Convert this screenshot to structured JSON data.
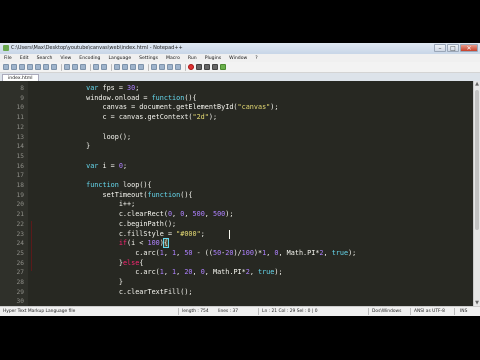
{
  "window": {
    "title": "C:\\Users\\Max\\Desktop\\youtube\\canvas\\web\\index.html - Notepad++",
    "minimize": "–",
    "maximize": "□",
    "close": "✕"
  },
  "menu": [
    "File",
    "Edit",
    "Search",
    "View",
    "Encoding",
    "Language",
    "Settings",
    "Macro",
    "Run",
    "Plugins",
    "Window",
    "?"
  ],
  "tab": {
    "label": "index.html"
  },
  "editor": {
    "lines": [
      {
        "n": "8",
        "html": "            <span class='k'>var</span> fps = <span class='n'>30</span>;"
      },
      {
        "n": "9",
        "html": "            window.onload = <span class='k'>function</span>(){"
      },
      {
        "n": "10",
        "html": "                canvas = document.getElementById(<span class='s'>\"canvas\"</span>);"
      },
      {
        "n": "11",
        "html": "                c = canvas.getContext(<span class='s'>\"2d\"</span>);"
      },
      {
        "n": "12",
        "html": ""
      },
      {
        "n": "13",
        "html": "                loop();"
      },
      {
        "n": "14",
        "html": "            }"
      },
      {
        "n": "15",
        "html": ""
      },
      {
        "n": "16",
        "html": "            <span class='k'>var</span> i = <span class='n'>0</span>;"
      },
      {
        "n": "17",
        "html": ""
      },
      {
        "n": "18",
        "html": "            <span class='k'>function</span> loop(){"
      },
      {
        "n": "19",
        "html": "                setTimeout(<span class='k'>function</span>(){"
      },
      {
        "n": "20",
        "html": "                    i++;"
      },
      {
        "n": "21",
        "html": "                    c.clearRect(<span class='n'>0</span>, <span class='n'>0</span>, <span class='n'>500</span>, <span class='n'>500</span>);"
      },
      {
        "n": "22",
        "html": "                    c.beginPath();"
      },
      {
        "n": "23",
        "html": "                    c.fillStyle = <span class='s'>\"#000\"</span>;"
      },
      {
        "n": "24",
        "html": "                    <span class='kw'>if</span>(i &lt; <span class='n'>100</span>)<span class='hl'>{</span>"
      },
      {
        "n": "25",
        "html": "                        c.arc(<span class='n'>1</span>, <span class='n'>1</span>, <span class='n'>50</span> - ((<span class='n'>50</span>-<span class='n'>20</span>)/<span class='n'>100</span>)*<span class='n'>1</span>, <span class='n'>0</span>, Math.PI*<span class='n'>2</span>, <span class='k'>true</span>);"
      },
      {
        "n": "26",
        "html": "                    }<span class='kw'>else</span>{"
      },
      {
        "n": "27",
        "html": "                        c.arc(<span class='n'>1</span>, <span class='n'>1</span>, <span class='n'>20</span>, <span class='n'>0</span>, Math.PI*<span class='n'>2</span>, <span class='k'>true</span>);"
      },
      {
        "n": "28",
        "html": "                    }"
      },
      {
        "n": "29",
        "html": "                    c.clearTextFill();"
      },
      {
        "n": "30",
        "html": ""
      }
    ]
  },
  "status": {
    "language": "Hyper Text Markup Language file",
    "length": "length : 754",
    "lines": "lines : 37",
    "position": "Ln : 21   Col : 29   Sel : 0 | 0",
    "eol": "Dos\\Windows",
    "encoding": "ANSI as UTF-8",
    "mode": "INS"
  }
}
